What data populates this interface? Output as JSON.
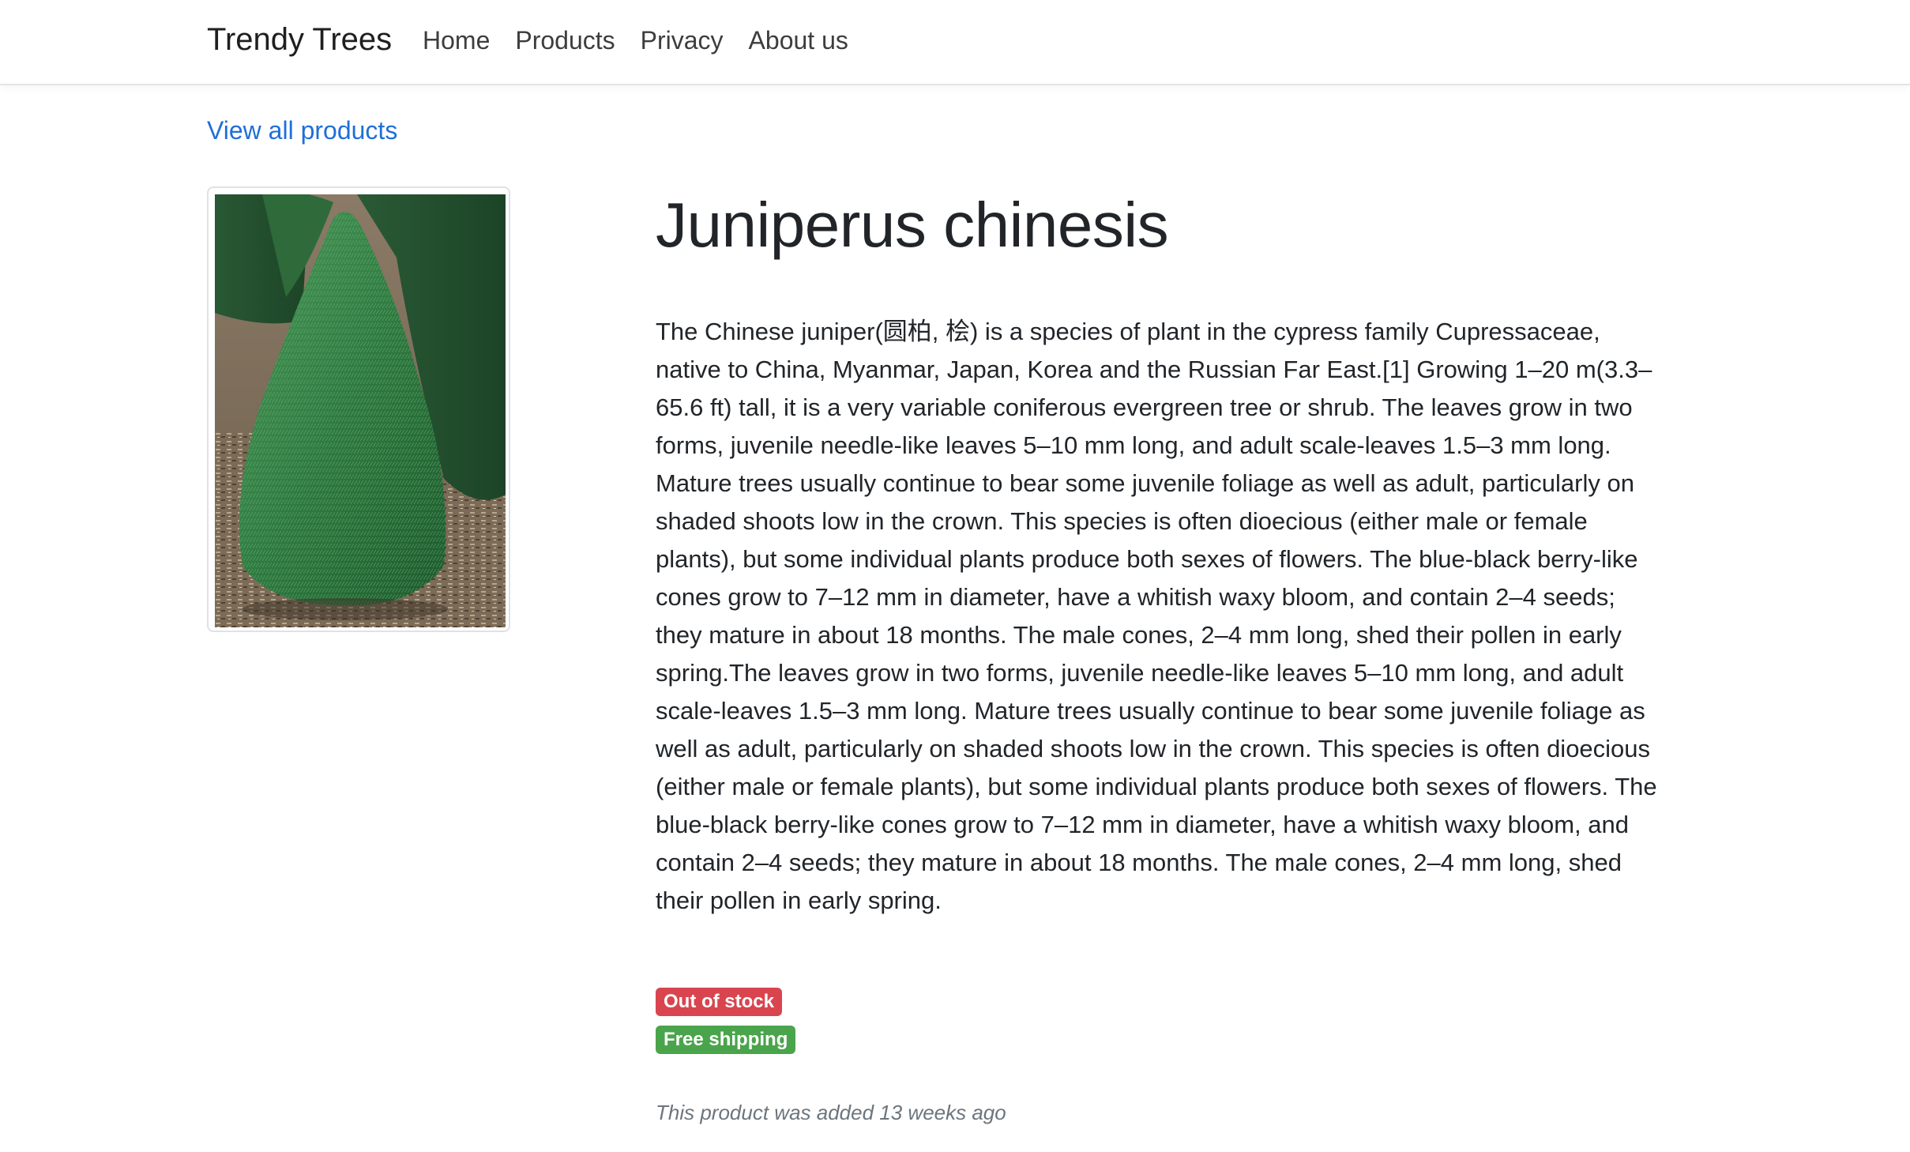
{
  "navbar": {
    "brand": "Trendy Trees",
    "links": [
      "Home",
      "Products",
      "Privacy",
      "About us"
    ]
  },
  "back_link": "View all products",
  "product": {
    "title": "Juniperus chinesis",
    "description": "The Chinese juniper(圆柏, 桧) is a species of plant in the cypress family Cupressaceae, native to China, Myanmar, Japan, Korea and the Russian Far East.[1] Growing 1–20 m(3.3–65.6 ft) tall, it is a very variable coniferous evergreen tree or shrub. The leaves grow in two forms, juvenile needle-like leaves 5–10 mm long, and adult scale-leaves 1.5–3 mm long. Mature trees usually continue to bear some juvenile foliage as well as adult, particularly on shaded shoots low in the crown. This species is often dioecious (either male or female plants), but some individual plants produce both sexes of flowers. The blue-black berry-like cones grow to 7–12 mm in diameter, have a whitish waxy bloom, and contain 2–4 seeds; they mature in about 18 months. The male cones, 2–4 mm long, shed their pollen in early spring.The leaves grow in two forms, juvenile needle-like leaves 5–10 mm long, and adult scale-leaves 1.5–3 mm long. Mature trees usually continue to bear some juvenile foliage as well as adult, particularly on shaded shoots low in the crown. This species is often dioecious (either male or female plants), but some individual plants produce both sexes of flowers. The blue-black berry-like cones grow to 7–12 mm in diameter, have a whitish waxy bloom, and contain 2–4 seeds; they mature in about 18 months. The male cones, 2–4 mm long, shed their pollen in early spring.",
    "badges": {
      "stock": "Out of stock",
      "shipping": "Free shipping"
    },
    "added_note": "This product was added 13 weeks ago"
  },
  "colors": {
    "link": "#1f6fd8",
    "badge_out_of_stock": "#d9454f",
    "badge_free_shipping": "#4aa44c",
    "muted_text": "#6c757d"
  }
}
